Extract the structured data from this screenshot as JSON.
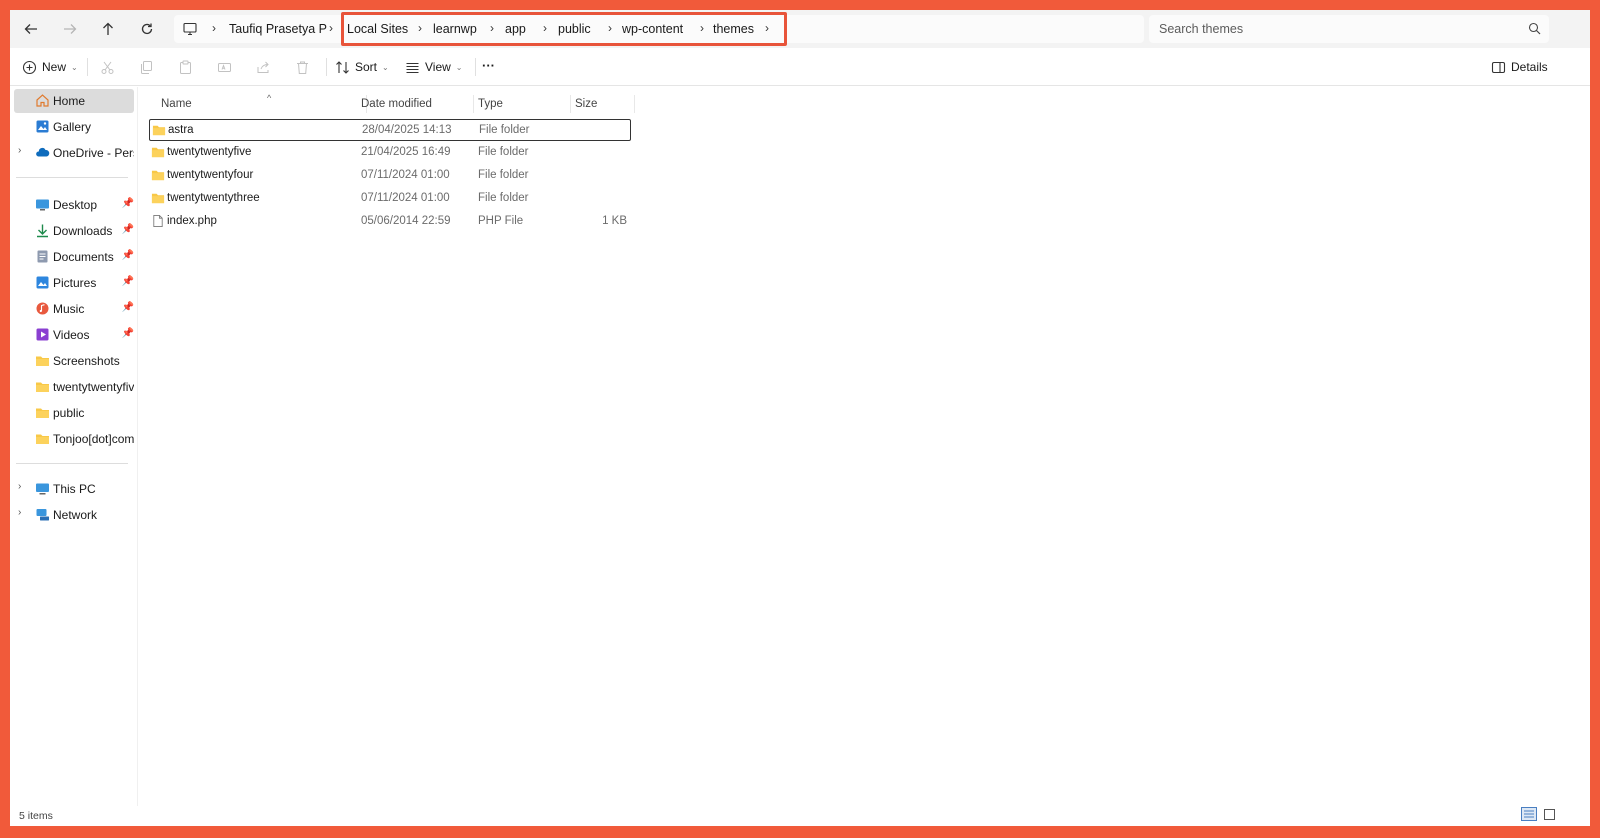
{
  "nav": {
    "back_label": "Back",
    "forward_label": "Forward",
    "up_label": "Up",
    "refresh_label": "Refresh"
  },
  "breadcrumb": {
    "items": [
      "Taufiq Prasetya P",
      "Local Sites",
      "learnwp",
      "app",
      "public",
      "wp-content",
      "themes"
    ]
  },
  "search": {
    "placeholder": "Search themes"
  },
  "toolbar": {
    "new_label": "New",
    "sort_label": "Sort",
    "view_label": "View",
    "more_label": "···",
    "details_label": "Details"
  },
  "sidebar": {
    "items": [
      {
        "label": "Home",
        "icon": "home-icon",
        "selected": true
      },
      {
        "label": "Gallery",
        "icon": "gallery-icon"
      },
      {
        "label": "OneDrive - Persona",
        "icon": "onedrive-icon"
      },
      {
        "label": "Desktop",
        "icon": "desktop-icon",
        "pinned": true
      },
      {
        "label": "Downloads",
        "icon": "downloads-icon",
        "pinned": true
      },
      {
        "label": "Documents",
        "icon": "documents-icon",
        "pinned": true
      },
      {
        "label": "Pictures",
        "icon": "pictures-icon",
        "pinned": true
      },
      {
        "label": "Music",
        "icon": "music-icon",
        "pinned": true
      },
      {
        "label": "Videos",
        "icon": "videos-icon",
        "pinned": true
      },
      {
        "label": "Screenshots",
        "icon": "folder-icon"
      },
      {
        "label": "twentytwentyfive",
        "icon": "folder-icon"
      },
      {
        "label": "public",
        "icon": "folder-icon"
      },
      {
        "label": "Tonjoo[dot]com Ca",
        "icon": "folder-icon"
      },
      {
        "label": "This PC",
        "icon": "this-pc-icon"
      },
      {
        "label": "Network",
        "icon": "network-icon"
      }
    ]
  },
  "columns": {
    "name": "Name",
    "date": "Date modified",
    "type": "Type",
    "size": "Size"
  },
  "files": [
    {
      "name": "astra",
      "date": "28/04/2025 14:13",
      "type": "File folder",
      "size": "",
      "icon": "folder-icon"
    },
    {
      "name": "twentytwentyfive",
      "date": "21/04/2025 16:49",
      "type": "File folder",
      "size": "",
      "icon": "folder-icon"
    },
    {
      "name": "twentytwentyfour",
      "date": "07/11/2024 01:00",
      "type": "File folder",
      "size": "",
      "icon": "folder-icon"
    },
    {
      "name": "twentytwentythree",
      "date": "07/11/2024 01:00",
      "type": "File folder",
      "size": "",
      "icon": "folder-icon"
    },
    {
      "name": "index.php",
      "date": "05/06/2014 22:59",
      "type": "PHP File",
      "size": "1 KB",
      "icon": "file-icon"
    }
  ],
  "status": {
    "item_count": "5 items"
  },
  "colors": {
    "frame": "#F15A3A",
    "highlight_border": "#E8543A",
    "folder": "#F8C847",
    "selected_bg": "#DCDCDC"
  }
}
